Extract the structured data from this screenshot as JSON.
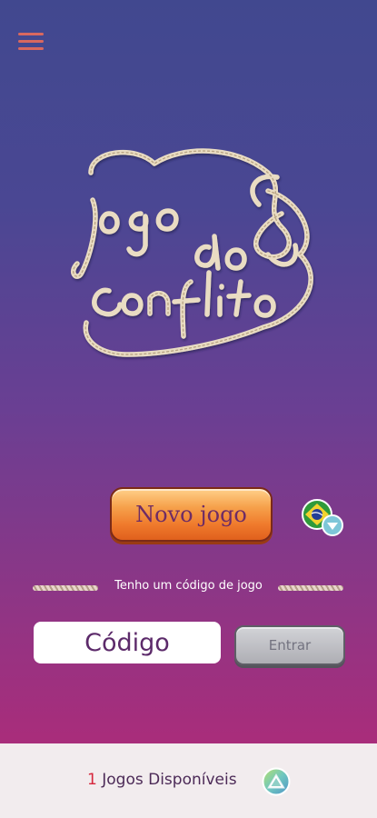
{
  "menu": {
    "icon": "hamburger-menu-icon"
  },
  "logo": {
    "lines": [
      "jogo",
      "do",
      "conflito"
    ],
    "style": "rope-lettering"
  },
  "actions": {
    "new_game_label": "Novo jogo",
    "language_icon": "brazil-flag-icon",
    "language_dropdown_icon": "chevron-down-icon"
  },
  "code_section": {
    "divider_text": "Tenho um código de jogo",
    "placeholder": "Código",
    "enter_label": "Entrar"
  },
  "footer": {
    "available_count": "1",
    "available_label": "Jogos Disponíveis",
    "refresh_icon": "refresh-icon"
  },
  "colors": {
    "bg_top": "#41488f",
    "bg_bottom": "#a52c7a",
    "menu": "#d9685f",
    "new_game_button": "#ef7a2c",
    "enter_button": "#aeaeb4",
    "count": "#d6263c",
    "footer_bg": "#f2ecee"
  }
}
